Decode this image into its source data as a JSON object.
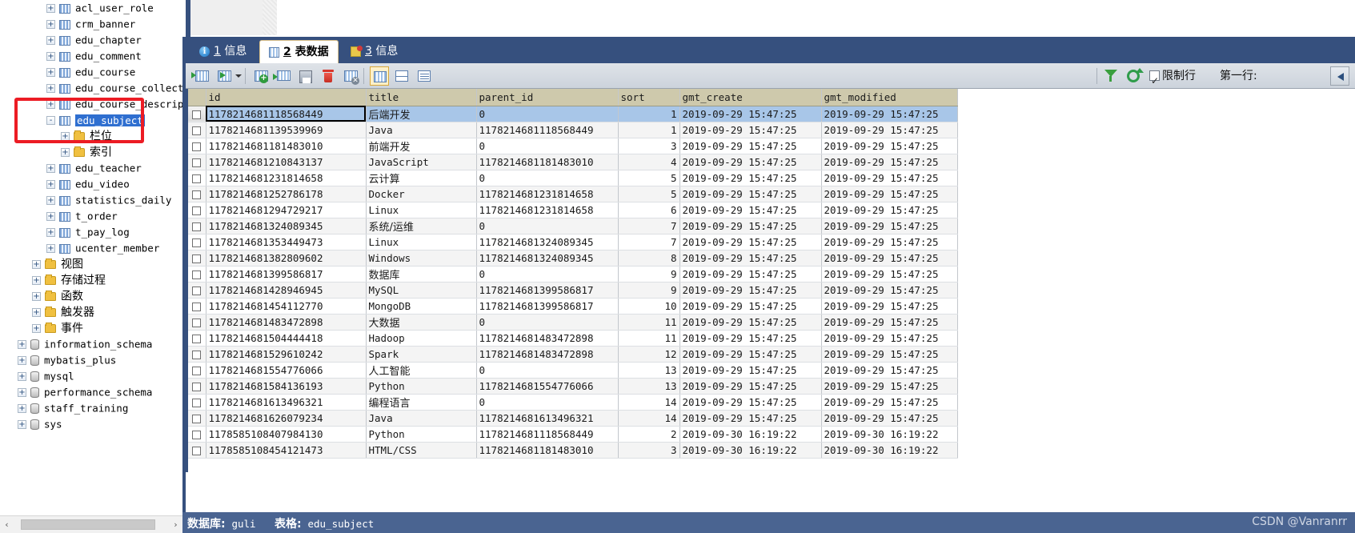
{
  "tree": {
    "items": [
      {
        "label": "acl_user_role",
        "icon": "table-icon",
        "indent": 3,
        "toggle": "+",
        "kind": "table"
      },
      {
        "label": "crm_banner",
        "icon": "table-icon",
        "indent": 3,
        "toggle": "+",
        "kind": "table"
      },
      {
        "label": "edu_chapter",
        "icon": "table-icon",
        "indent": 3,
        "toggle": "+",
        "kind": "table"
      },
      {
        "label": "edu_comment",
        "icon": "table-icon",
        "indent": 3,
        "toggle": "+",
        "kind": "table"
      },
      {
        "label": "edu_course",
        "icon": "table-icon",
        "indent": 3,
        "toggle": "+",
        "kind": "table"
      },
      {
        "label": "edu_course_collect",
        "icon": "table-icon",
        "indent": 3,
        "toggle": "+",
        "kind": "table"
      },
      {
        "label": "edu_course_description",
        "icon": "table-icon",
        "indent": 3,
        "toggle": "+",
        "kind": "table"
      },
      {
        "label": "edu_subject",
        "icon": "table-icon",
        "indent": 3,
        "toggle": "-",
        "kind": "table",
        "selected": true
      },
      {
        "label": "栏位",
        "icon": "folder-icon",
        "indent": 4,
        "toggle": "+",
        "kind": "folder",
        "cjk": true
      },
      {
        "label": "索引",
        "icon": "folder-icon",
        "indent": 4,
        "toggle": "+",
        "kind": "folder",
        "cjk": true
      },
      {
        "label": "edu_teacher",
        "icon": "table-icon",
        "indent": 3,
        "toggle": "+",
        "kind": "table"
      },
      {
        "label": "edu_video",
        "icon": "table-icon",
        "indent": 3,
        "toggle": "+",
        "kind": "table"
      },
      {
        "label": "statistics_daily",
        "icon": "table-icon",
        "indent": 3,
        "toggle": "+",
        "kind": "table"
      },
      {
        "label": "t_order",
        "icon": "table-icon",
        "indent": 3,
        "toggle": "+",
        "kind": "table"
      },
      {
        "label": "t_pay_log",
        "icon": "table-icon",
        "indent": 3,
        "toggle": "+",
        "kind": "table"
      },
      {
        "label": "ucenter_member",
        "icon": "table-icon",
        "indent": 3,
        "toggle": "+",
        "kind": "table"
      },
      {
        "label": "视图",
        "icon": "folder-icon",
        "indent": 2,
        "toggle": "+",
        "kind": "folder",
        "cjk": true
      },
      {
        "label": "存储过程",
        "icon": "folder-icon",
        "indent": 2,
        "toggle": "+",
        "kind": "folder",
        "cjk": true
      },
      {
        "label": "函数",
        "icon": "folder-icon",
        "indent": 2,
        "toggle": "+",
        "kind": "folder",
        "cjk": true
      },
      {
        "label": "触发器",
        "icon": "folder-icon",
        "indent": 2,
        "toggle": "+",
        "kind": "folder",
        "cjk": true
      },
      {
        "label": "事件",
        "icon": "folder-icon",
        "indent": 2,
        "toggle": "+",
        "kind": "folder",
        "cjk": true
      },
      {
        "label": "information_schema",
        "icon": "database-icon",
        "indent": 1,
        "toggle": "+",
        "kind": "db"
      },
      {
        "label": "mybatis_plus",
        "icon": "database-icon",
        "indent": 1,
        "toggle": "+",
        "kind": "db"
      },
      {
        "label": "mysql",
        "icon": "database-icon",
        "indent": 1,
        "toggle": "+",
        "kind": "db"
      },
      {
        "label": "performance_schema",
        "icon": "database-icon",
        "indent": 1,
        "toggle": "+",
        "kind": "db"
      },
      {
        "label": "staff_training",
        "icon": "database-icon",
        "indent": 1,
        "toggle": "+",
        "kind": "db"
      },
      {
        "label": "sys",
        "icon": "database-icon",
        "indent": 1,
        "toggle": "+",
        "kind": "db"
      }
    ],
    "scroll_left_arrow": "‹",
    "scroll_right_arrow": "›"
  },
  "tabs": [
    {
      "num": "1",
      "label": "信息",
      "icon": "info-icon",
      "active": false
    },
    {
      "num": "2",
      "label": "表数据",
      "icon": "grid-icon",
      "active": true
    },
    {
      "num": "3",
      "label": "信息",
      "icon": "object-icon",
      "active": false
    }
  ],
  "toolbar": {
    "buttons": [
      {
        "name": "import-wizard-button",
        "icon": "import-table-icon"
      },
      {
        "name": "export-wizard-button",
        "icon": "export-table-icon"
      },
      {
        "name": "add-record-button",
        "icon": "add-record-icon"
      },
      {
        "name": "delete-record-button",
        "icon": "remove-record-icon"
      },
      {
        "name": "save-record-button",
        "icon": "save-icon"
      },
      {
        "name": "trash-button",
        "icon": "trash-icon"
      },
      {
        "name": "cancel-edit-button",
        "icon": "cancel-record-icon"
      },
      {
        "name": "grid-view-button",
        "icon": "grid-view-icon"
      },
      {
        "name": "form-view-button",
        "icon": "form-view-icon"
      },
      {
        "name": "text-view-button",
        "icon": "text-view-icon"
      }
    ],
    "filter_label": "filter-icon",
    "refresh_label": "refresh-icon",
    "limit_checkbox_label": "限制行",
    "first_row_label": "第一行:"
  },
  "grid": {
    "columns": [
      "id",
      "title",
      "parent_id",
      "sort",
      "gmt_create",
      "gmt_modified"
    ],
    "rows": [
      [
        "1178214681118568449",
        "后端开发",
        "0",
        "1",
        "2019-09-29 15:47:25",
        "2019-09-29 15:47:25"
      ],
      [
        "1178214681139539969",
        "Java",
        "1178214681118568449",
        "1",
        "2019-09-29 15:47:25",
        "2019-09-29 15:47:25"
      ],
      [
        "1178214681181483010",
        "前端开发",
        "0",
        "3",
        "2019-09-29 15:47:25",
        "2019-09-29 15:47:25"
      ],
      [
        "1178214681210843137",
        "JavaScript",
        "1178214681181483010",
        "4",
        "2019-09-29 15:47:25",
        "2019-09-29 15:47:25"
      ],
      [
        "1178214681231814658",
        "云计算",
        "0",
        "5",
        "2019-09-29 15:47:25",
        "2019-09-29 15:47:25"
      ],
      [
        "1178214681252786178",
        "Docker",
        "1178214681231814658",
        "5",
        "2019-09-29 15:47:25",
        "2019-09-29 15:47:25"
      ],
      [
        "1178214681294729217",
        "Linux",
        "1178214681231814658",
        "6",
        "2019-09-29 15:47:25",
        "2019-09-29 15:47:25"
      ],
      [
        "1178214681324089345",
        "系统/运维",
        "0",
        "7",
        "2019-09-29 15:47:25",
        "2019-09-29 15:47:25"
      ],
      [
        "1178214681353449473",
        "Linux",
        "1178214681324089345",
        "7",
        "2019-09-29 15:47:25",
        "2019-09-29 15:47:25"
      ],
      [
        "1178214681382809602",
        "Windows",
        "1178214681324089345",
        "8",
        "2019-09-29 15:47:25",
        "2019-09-29 15:47:25"
      ],
      [
        "1178214681399586817",
        "数据库",
        "0",
        "9",
        "2019-09-29 15:47:25",
        "2019-09-29 15:47:25"
      ],
      [
        "1178214681428946945",
        "MySQL",
        "1178214681399586817",
        "9",
        "2019-09-29 15:47:25",
        "2019-09-29 15:47:25"
      ],
      [
        "1178214681454112770",
        "MongoDB",
        "1178214681399586817",
        "10",
        "2019-09-29 15:47:25",
        "2019-09-29 15:47:25"
      ],
      [
        "1178214681483472898",
        "大数据",
        "0",
        "11",
        "2019-09-29 15:47:25",
        "2019-09-29 15:47:25"
      ],
      [
        "1178214681504444418",
        "Hadoop",
        "1178214681483472898",
        "11",
        "2019-09-29 15:47:25",
        "2019-09-29 15:47:25"
      ],
      [
        "1178214681529610242",
        "Spark",
        "1178214681483472898",
        "12",
        "2019-09-29 15:47:25",
        "2019-09-29 15:47:25"
      ],
      [
        "1178214681554776066",
        "人工智能",
        "0",
        "13",
        "2019-09-29 15:47:25",
        "2019-09-29 15:47:25"
      ],
      [
        "1178214681584136193",
        "Python",
        "1178214681554776066",
        "13",
        "2019-09-29 15:47:25",
        "2019-09-29 15:47:25"
      ],
      [
        "1178214681613496321",
        "编程语言",
        "0",
        "14",
        "2019-09-29 15:47:25",
        "2019-09-29 15:47:25"
      ],
      [
        "1178214681626079234",
        "Java",
        "1178214681613496321",
        "14",
        "2019-09-29 15:47:25",
        "2019-09-29 15:47:25"
      ],
      [
        "1178585108407984130",
        "Python",
        "1178214681118568449",
        "2",
        "2019-09-30 16:19:22",
        "2019-09-30 16:19:22"
      ],
      [
        "1178585108454121473",
        "HTML/CSS",
        "1178214681181483010",
        "3",
        "2019-09-30 16:19:22",
        "2019-09-30 16:19:22"
      ]
    ],
    "selected_row_index": 0
  },
  "statusbar": {
    "db_key": "数据库:",
    "db_value": "guli",
    "table_key": "表格:",
    "table_value": "edu_subject",
    "watermark": "CSDN @Vanranrr"
  }
}
